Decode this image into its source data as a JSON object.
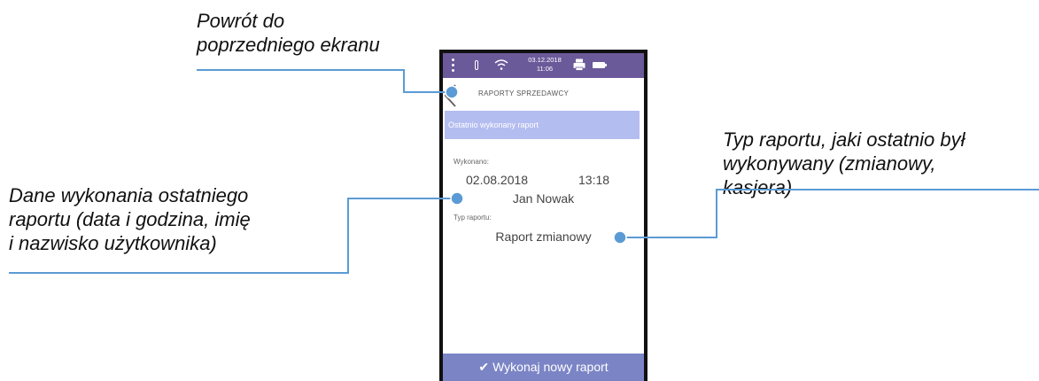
{
  "callouts": {
    "back": [
      "Powrót do",
      "poprzedniego ekranu"
    ],
    "report_type": [
      "Typ raportu, jaki ostatnio był",
      "wykonywany (zmianowy,",
      "kasjera)"
    ],
    "execution": [
      "Dane wykonania ostatniego",
      "raportu (data i godzina, imię",
      "i nazwisko użytkownika)"
    ]
  },
  "status_bar": {
    "date": "03.12.2018",
    "time": "11:06",
    "icons": [
      "menu-dots-icon",
      "thermometer-icon",
      "wifi-icon",
      "printer-icon",
      "battery-icon"
    ]
  },
  "screen": {
    "title": "RAPORTY SPRZEDAWCY",
    "banner": "Ostatnio wykonany raport",
    "executed_label": "Wykonano:",
    "executed_date": "02.08.2018",
    "executed_time": "13:18",
    "executed_user": "Jan Nowak",
    "type_label": "Typ raportu:",
    "type_value": "Raport zmianowy",
    "action_button": "Wykonaj nowy raport"
  },
  "colors": {
    "status_bar": "#6b5a9a",
    "banner": "#b4bdf0",
    "action_button": "#7b85c6",
    "callout_line": "#5b9bd5"
  }
}
